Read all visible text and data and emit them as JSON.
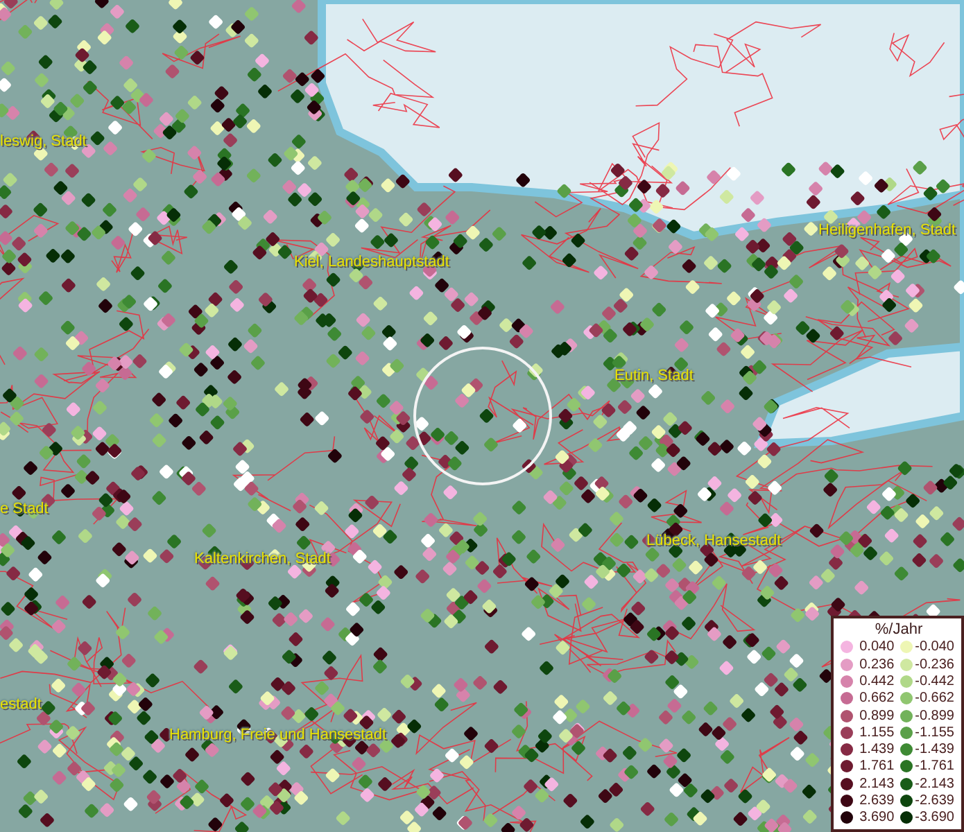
{
  "map": {
    "places": [
      {
        "name": "leswig, Stadt"
      },
      {
        "name": "Heiligenhafen, Stadt"
      },
      {
        "name": "Kiel, Landeshauptstadt"
      },
      {
        "name": "Eutin, Stadt"
      },
      {
        "name": "e Stadt"
      },
      {
        "name": "Lübeck, Hansestadt"
      },
      {
        "name": "Kaltenkirchen, Stadt"
      },
      {
        "name": "estadt"
      },
      {
        "name": "Hamburg, Freie und Hansestadt"
      }
    ]
  },
  "legend": {
    "title": "%/Jahr",
    "rows": [
      {
        "left": {
          "label": "0.040",
          "color": "#f4b4e0"
        },
        "right": {
          "label": "-0.040",
          "color": "#eef6b4"
        }
      },
      {
        "left": {
          "label": "0.236",
          "color": "#e49cc4"
        },
        "right": {
          "label": "-0.236",
          "color": "#cfe8a0"
        }
      },
      {
        "left": {
          "label": "0.442",
          "color": "#d683ab"
        },
        "right": {
          "label": "-0.442",
          "color": "#b0d888"
        }
      },
      {
        "left": {
          "label": "0.662",
          "color": "#c66b93"
        },
        "right": {
          "label": "-0.662",
          "color": "#90c670"
        }
      },
      {
        "left": {
          "label": "0.899",
          "color": "#b0536f"
        },
        "right": {
          "label": "-0.899",
          "color": "#72b25a"
        }
      },
      {
        "left": {
          "label": "1.155",
          "color": "#9a3e59"
        },
        "right": {
          "label": "-1.155",
          "color": "#5aa048"
        }
      },
      {
        "left": {
          "label": "1.439",
          "color": "#862a44"
        },
        "right": {
          "label": "-1.439",
          "color": "#3e8a34"
        }
      },
      {
        "left": {
          "label": "1.761",
          "color": "#6e1a30"
        },
        "right": {
          "label": "-1.761",
          "color": "#2a7424"
        }
      },
      {
        "left": {
          "label": "2.143",
          "color": "#560e20"
        },
        "right": {
          "label": "-2.143",
          "color": "#1a5c18"
        }
      },
      {
        "left": {
          "label": "2.639",
          "color": "#3e0714"
        },
        "right": {
          "label": "-2.639",
          "color": "#0e460e"
        }
      },
      {
        "left": {
          "label": "3.690",
          "color": "#22020a"
        },
        "right": {
          "label": "-3.690",
          "color": "#062e06"
        }
      }
    ]
  }
}
